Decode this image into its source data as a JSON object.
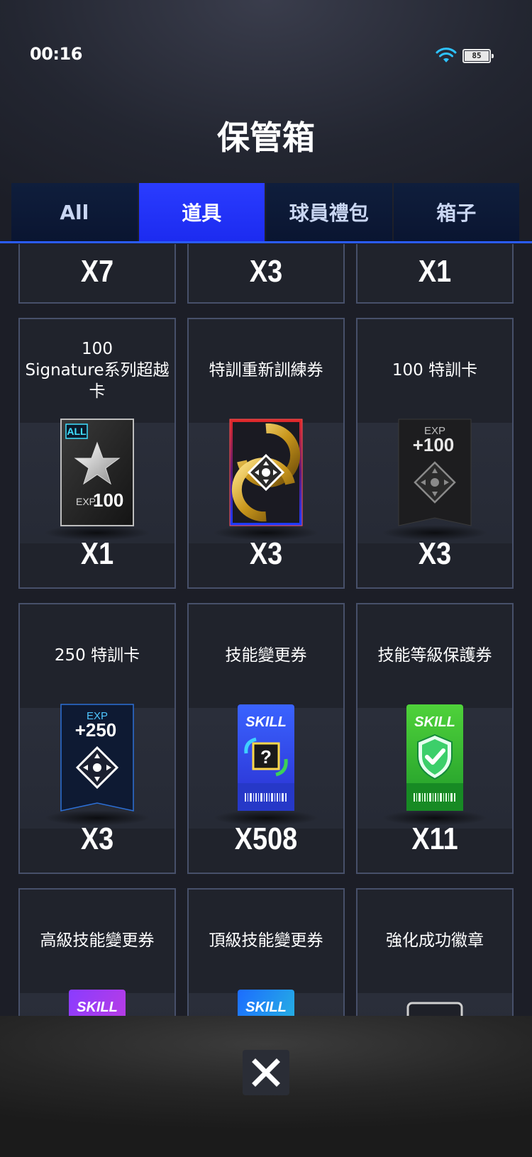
{
  "status": {
    "time": "00:16",
    "battery": "85",
    "wifi_icon": "wifi-icon"
  },
  "title": "保管箱",
  "tabs": [
    {
      "label": "All",
      "active": false
    },
    {
      "label": "道具",
      "active": true
    },
    {
      "label": "球員禮包",
      "active": false
    },
    {
      "label": "箱子",
      "active": false
    }
  ],
  "items": [
    {
      "name": "",
      "qty": "X7",
      "icon": "none"
    },
    {
      "name": "",
      "qty": "X3",
      "icon": "none"
    },
    {
      "name": "",
      "qty": "X1",
      "icon": "none"
    },
    {
      "name": "100\nSignature系列超越卡",
      "qty": "X1",
      "icon": "signature-card-icon",
      "badge": "ALL",
      "exp_label": "EXP",
      "exp_value": "100"
    },
    {
      "name": "特訓重新訓練券",
      "qty": "X3",
      "icon": "retrain-ticket-icon"
    },
    {
      "name": "100 特訓卡",
      "qty": "X3",
      "icon": "training-card-100-icon",
      "exp_label": "EXP",
      "exp_value": "+100"
    },
    {
      "name": "250 特訓卡",
      "qty": "X3",
      "icon": "training-card-250-icon",
      "exp_label": "EXP",
      "exp_value": "+250"
    },
    {
      "name": "技能變更券",
      "qty": "X508",
      "icon": "skill-change-ticket-icon",
      "skill_label": "SKILL"
    },
    {
      "name": "技能等級保護券",
      "qty": "X11",
      "icon": "skill-protect-ticket-icon",
      "skill_label": "SKILL"
    },
    {
      "name": "高級技能變更券",
      "qty": "",
      "icon": "advanced-skill-ticket-icon",
      "skill_label": "SKILL"
    },
    {
      "name": "頂級技能變更券",
      "qty": "",
      "icon": "top-skill-ticket-icon",
      "skill_label": "SKILL"
    },
    {
      "name": "強化成功徽章",
      "qty": "",
      "icon": "enhance-badge-icon"
    }
  ],
  "close_icon": "close-icon"
}
